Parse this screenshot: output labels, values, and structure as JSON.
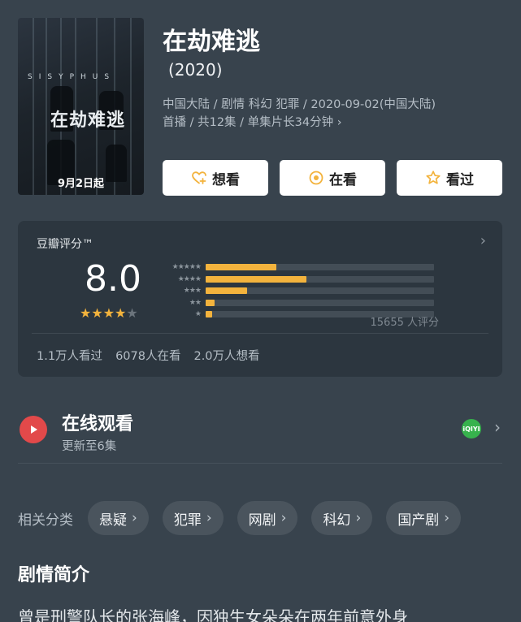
{
  "poster": {
    "band_text": "SISYPHUS",
    "title_text": "在劫难逃",
    "date_caption": "9月2日起"
  },
  "header": {
    "title": "在劫难逃",
    "year": "(2020)",
    "meta_line1": "中国大陆 / 剧情 科幻 犯罪 / 2020-09-02(中国大陆)",
    "meta_line2": "首播 / 共12集 / 单集片长34分钟",
    "meta_chevron": "›"
  },
  "actions": [
    {
      "label": "想看",
      "icon": "heart-plus-icon"
    },
    {
      "label": "在看",
      "icon": "target-circle-icon"
    },
    {
      "label": "看过",
      "icon": "star-outline-icon"
    }
  ],
  "rating": {
    "title": "豆瓣评分™",
    "score": "8.0",
    "stars": 4,
    "max_stars": 5,
    "distribution": [
      {
        "label": "★★★★★",
        "fraction": 0.31
      },
      {
        "label": "★★★★",
        "fraction": 0.44
      },
      {
        "label": "★★★",
        "fraction": 0.18
      },
      {
        "label": "★★",
        "fraction": 0.04
      },
      {
        "label": "★",
        "fraction": 0.03
      }
    ],
    "count": "15655 人评分",
    "stats": [
      "1.1万人看过",
      "6078人在看",
      "2.0万人想看"
    ],
    "accent_color": "#f3b33d"
  },
  "watch": {
    "title": "在线观看",
    "subtitle": "更新至6集",
    "provider_icon": "iqiyi-icon",
    "provider_text": "iQIYI"
  },
  "tags": {
    "label": "相关分类",
    "items": [
      "悬疑",
      "犯罪",
      "网剧",
      "科幻",
      "国产剧"
    ]
  },
  "synopsis": {
    "title": "剧情简介",
    "text": "曾是刑警队长的张海峰，因独生女朵朵在两年前意外身"
  }
}
